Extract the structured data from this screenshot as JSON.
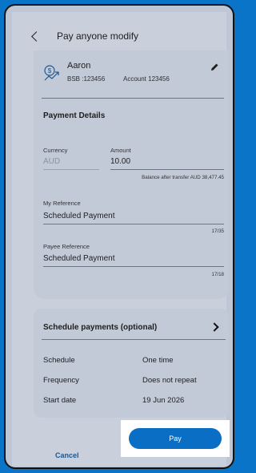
{
  "header": {
    "title": "Pay anyone modify"
  },
  "payee": {
    "name": "Aaron",
    "bsb": "BSB :123456",
    "account": "Account 123456"
  },
  "payment_details": {
    "title": "Payment Details",
    "currency_label": "Currency",
    "currency_value": "AUD",
    "amount_label": "Amount",
    "amount_value": "10.00",
    "balance_note": "Balance after transfer AUD 38,477.45",
    "my_reference_label": "My Reference",
    "my_reference_value": "Scheduled Payment",
    "my_reference_count": "17/35",
    "payee_reference_label": "Payee Reference",
    "payee_reference_value": "Scheduled Payment",
    "payee_reference_count": "17/18"
  },
  "schedule": {
    "title": "Schedule payments (optional)",
    "rows": [
      {
        "label": "Schedule",
        "value": "One time"
      },
      {
        "label": "Frequency",
        "value": "Does not repeat"
      },
      {
        "label": "Start date",
        "value": "19 Jun 2026"
      }
    ]
  },
  "actions": {
    "cancel": "Cancel",
    "pay": "Pay"
  },
  "colors": {
    "brand_blue": "#0a74c8",
    "button_blue": "#0a6fc4"
  }
}
